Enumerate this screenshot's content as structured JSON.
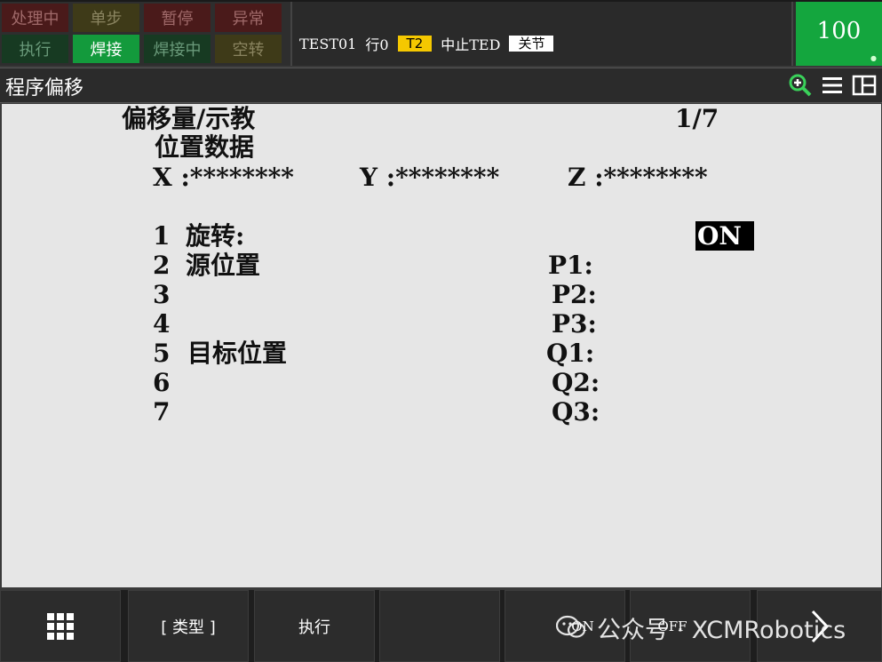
{
  "status": {
    "indicators": [
      {
        "label": "处理中",
        "state": "red"
      },
      {
        "label": "单步",
        "state": "olive"
      },
      {
        "label": "暂停",
        "state": "red"
      },
      {
        "label": "异常",
        "state": "red"
      },
      {
        "label": "执行",
        "state": "green-dim"
      },
      {
        "label": "焊接",
        "state": "green-on"
      },
      {
        "label": "焊接中",
        "state": "green-dim"
      },
      {
        "label": "空转",
        "state": "olive"
      }
    ],
    "program": "TEST01",
    "line": "行0",
    "mode": "T2",
    "state_text": "中止TED",
    "coord": "关节",
    "override": "100"
  },
  "title": "程序偏移",
  "content": {
    "heading": "偏移量/示教",
    "page": "1/7",
    "subheading": "位置数据",
    "x": "X :********",
    "y": "Y :********",
    "z": "Z :********",
    "rows": [
      {
        "num": "1",
        "label": "旋转:",
        "right": ""
      },
      {
        "num": "2",
        "label": "源位置",
        "right": "P1:"
      },
      {
        "num": "3",
        "label": "",
        "right": "P2:"
      },
      {
        "num": "4",
        "label": "",
        "right": "P3:"
      },
      {
        "num": "5",
        "label": "目标位置",
        "right": "Q1:"
      },
      {
        "num": "6",
        "label": "",
        "right": "Q2:"
      },
      {
        "num": "7",
        "label": "",
        "right": "Q3:"
      }
    ],
    "rotate_value": "ON"
  },
  "fkeys": {
    "type": "[ 类型 ]",
    "execute": "执行",
    "on": "ON",
    "off": "OFF"
  },
  "watermark": "公众号 · XCMRobotics",
  "colors": {
    "green_on": "#139a3c",
    "override_green": "#14a63e",
    "mode_yellow": "#f5c800",
    "content_bg": "#e6e6e6"
  }
}
